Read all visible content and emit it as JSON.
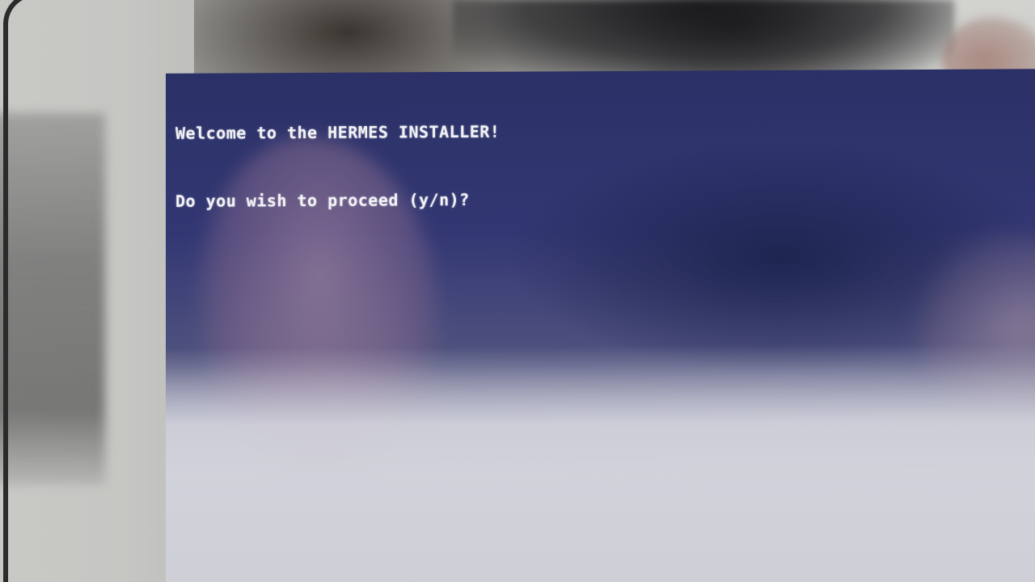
{
  "terminal": {
    "lines": [
      "Welcome to the HERMES INSTALLER!",
      "Do you wish to proceed (y/n)?"
    ]
  },
  "colors": {
    "screen_background": "#2b3166",
    "terminal_text": "#f2f2f6"
  }
}
